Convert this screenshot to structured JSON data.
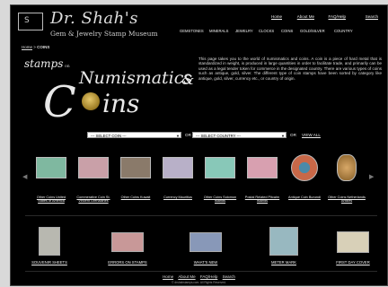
{
  "site": {
    "logo_mark": "S",
    "title": "Dr. Shah's",
    "subtitle": "Gem & Jewelry Stamp Museum"
  },
  "top_links": [
    "Home",
    "About Me",
    "FAQ/Help",
    "Search"
  ],
  "nav": [
    "GEMSTONES",
    "MINERALS",
    "JEWELRY",
    "CLOCKS",
    "COINS",
    "GOLD/SILVER",
    "COUNTRY"
  ],
  "breadcrumb": {
    "home": "Home",
    "sep": " > ",
    "current": "COINS"
  },
  "hero": {
    "stamps": "stamps",
    "on": "on",
    "numismatics": "Numismatics",
    "amp": "&",
    "c": "C",
    "ins": "ins"
  },
  "intro": "This page takes you to the world of numismatics and coins. A coin is a piece of hard metal that is standardized in weight, is produced in large quantities in order to facilitate trade, and primarily can be used as a legal tender token for commerce in the designated country. There are various types of coins such as antique, gold, silver. The different type of coin stamps have been sorted by category like antique, gold, silver, currency etc., or country of origin.",
  "selects": {
    "coin": "--- SELECT COIN ---",
    "or1": "OR",
    "country": "--- SELECT COUNTRY ---",
    "or2": "OR",
    "view_all": "VIEW ALL"
  },
  "carousel_nav": {
    "prev": "◀",
    "next": "▶"
  },
  "carousel": [
    {
      "label": "Other Coins United States of America",
      "color": "#7fb8a0"
    },
    {
      "label": "Commerative Coin St. Vincent Grenadines",
      "color": "#c9a0a8"
    },
    {
      "label": "Other Coins Kuwait",
      "color": "#8a7a6a"
    },
    {
      "label": "Currency Mauritius",
      "color": "#b8b0c8"
    },
    {
      "label": "Other Coins Solomon Islands",
      "color": "#88c8b8"
    },
    {
      "label": "Postal Related Pitcairn Islands",
      "color": "#d8a0b0"
    },
    {
      "label": "Antique Coin Burundi",
      "color": "#c86848"
    },
    {
      "label": "Other Coins Netherlands Antilles",
      "color": "#b88848"
    }
  ],
  "bottom_row": [
    {
      "label": "SOUVENIR SHEETS",
      "color": "#b8b8b0"
    },
    {
      "label": "ERRORS ON STAMPS",
      "color": "#c89898"
    },
    {
      "label": "WHAT'S NEW",
      "color": "#8898b8"
    },
    {
      "label": "METER MARK",
      "color": "#98b8c0"
    },
    {
      "label": "FIRST DAY COVER",
      "color": "#d8d0b8"
    }
  ],
  "footer_links": [
    "Home",
    "About Me",
    "FAQ/Help",
    "Search"
  ],
  "copyright": "© drshahstamps.com. All Rights Reserved."
}
